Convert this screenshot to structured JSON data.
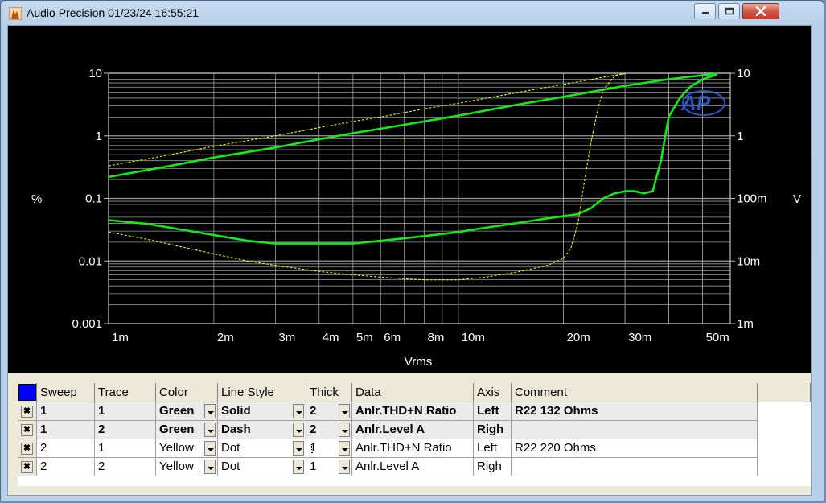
{
  "window": {
    "title": "Audio Precision  01/23/24 16:55:21",
    "minimize_label": "",
    "maximize_label": "",
    "close_label": ""
  },
  "colors": {
    "graph_bg": "#000000",
    "grid": "#9a9a9a",
    "trace_primary": "#18e818",
    "trace_secondary": "#f0f000",
    "selection": "#0000ff"
  },
  "chart_data": {
    "type": "line",
    "xlabel": "Vrms",
    "ylabel_left": "%",
    "ylabel_right": "V",
    "x_scale": "log",
    "y_scale": "log",
    "xlim": [
      0.001,
      0.06
    ],
    "ylim": [
      0.001,
      10
    ],
    "right_ylim": [
      0.001,
      10
    ],
    "grid": true,
    "watermark": "AP",
    "x_ticks": [
      {
        "value": 0.001,
        "label": "1m"
      },
      {
        "value": 0.002,
        "label": "2m"
      },
      {
        "value": 0.003,
        "label": "3m"
      },
      {
        "value": 0.004,
        "label": "4m"
      },
      {
        "value": 0.005,
        "label": "5m"
      },
      {
        "value": 0.006,
        "label": "6m"
      },
      {
        "value": 0.008,
        "label": "8m"
      },
      {
        "value": 0.01,
        "label": "10m"
      },
      {
        "value": 0.02,
        "label": "20m"
      },
      {
        "value": 0.03,
        "label": "30m"
      },
      {
        "value": 0.05,
        "label": "50m"
      }
    ],
    "y_ticks_left": [
      {
        "value": 10,
        "label": "10"
      },
      {
        "value": 1,
        "label": "1"
      },
      {
        "value": 0.1,
        "label": "0.1"
      },
      {
        "value": 0.01,
        "label": "0.01"
      },
      {
        "value": 0.001,
        "label": "0.001"
      }
    ],
    "y_ticks_right": [
      {
        "value": 10,
        "label": "10"
      },
      {
        "value": 1,
        "label": "1"
      },
      {
        "value": 0.1,
        "label": "100m"
      },
      {
        "value": 0.01,
        "label": "10m"
      },
      {
        "value": 0.001,
        "label": "1m"
      }
    ],
    "series": [
      {
        "name": "Anlr.THD+N Ratio",
        "sweep": 1,
        "color": "green",
        "style": "solid",
        "thick": 2,
        "axis": "left",
        "x": [
          0.001,
          0.0013,
          0.0016,
          0.002,
          0.0025,
          0.003,
          0.0035,
          0.004,
          0.0045,
          0.005,
          0.006,
          0.007,
          0.008,
          0.01,
          0.012,
          0.015,
          0.018,
          0.02,
          0.022,
          0.024,
          0.026,
          0.028,
          0.03,
          0.032,
          0.034,
          0.036,
          0.038,
          0.04,
          0.043,
          0.046,
          0.05,
          0.055
        ],
        "y": [
          0.045,
          0.039,
          0.032,
          0.026,
          0.021,
          0.019,
          0.019,
          0.019,
          0.019,
          0.019,
          0.021,
          0.023,
          0.025,
          0.029,
          0.034,
          0.041,
          0.048,
          0.052,
          0.056,
          0.07,
          0.1,
          0.12,
          0.13,
          0.13,
          0.12,
          0.13,
          0.4,
          2.0,
          4.0,
          6.0,
          8.0,
          9.5
        ]
      },
      {
        "name": "Anlr.Level A",
        "sweep": 1,
        "color": "green",
        "style": "dash",
        "thick": 2,
        "axis": "right",
        "x": [
          0.001,
          0.0015,
          0.002,
          0.003,
          0.004,
          0.005,
          0.006,
          0.008,
          0.01,
          0.015,
          0.02,
          0.03,
          0.04,
          0.05,
          0.055
        ],
        "y": [
          0.22,
          0.33,
          0.45,
          0.65,
          0.88,
          1.1,
          1.3,
          1.7,
          2.1,
          3.2,
          4.2,
          6.3,
          8.0,
          9.3,
          9.8
        ]
      },
      {
        "name": "Anlr.THD+N Ratio",
        "sweep": 2,
        "color": "yellow",
        "style": "dot",
        "thick": 1,
        "axis": "left",
        "x": [
          0.001,
          0.0013,
          0.0016,
          0.002,
          0.0025,
          0.003,
          0.004,
          0.005,
          0.006,
          0.007,
          0.008,
          0.01,
          0.012,
          0.015,
          0.018,
          0.02,
          0.021,
          0.022,
          0.023,
          0.024,
          0.025,
          0.026,
          0.028,
          0.03
        ],
        "y": [
          0.029,
          0.022,
          0.017,
          0.013,
          0.01,
          0.0085,
          0.0068,
          0.006,
          0.0055,
          0.0052,
          0.005,
          0.005,
          0.0055,
          0.0068,
          0.0085,
          0.011,
          0.016,
          0.04,
          0.2,
          0.8,
          2.5,
          5.5,
          9.0,
          10.0
        ]
      },
      {
        "name": "Anlr.Level A",
        "sweep": 2,
        "color": "yellow",
        "style": "dot",
        "thick": 1,
        "axis": "right",
        "x": [
          0.001,
          0.0015,
          0.002,
          0.003,
          0.004,
          0.005,
          0.006,
          0.008,
          0.01,
          0.015,
          0.02,
          0.025,
          0.028,
          0.03
        ],
        "y": [
          0.33,
          0.5,
          0.68,
          1.0,
          1.35,
          1.7,
          2.0,
          2.7,
          3.3,
          5.0,
          6.6,
          8.3,
          9.3,
          9.8
        ]
      }
    ]
  },
  "table": {
    "headers": [
      "",
      "Sweep",
      "Trace",
      "Color",
      "Line Style",
      "Thick",
      "Data",
      "Axis",
      "Comment"
    ],
    "rows": [
      {
        "sweep": "1",
        "trace": "1",
        "color": "Green",
        "line_style": "Solid",
        "thick": "2",
        "data": "Anlr.THD+N Ratio",
        "axis": "Left",
        "comment": "R22 132 Ohms"
      },
      {
        "sweep": "1",
        "trace": "2",
        "color": "Green",
        "line_style": "Dash",
        "thick": "2",
        "data": "Anlr.Level A",
        "axis": "Righ",
        "comment": ""
      },
      {
        "sweep": "2",
        "trace": "1",
        "color": "Yellow",
        "line_style": "Dot",
        "thick": "1",
        "data": "Anlr.THD+N Ratio",
        "axis": "Left",
        "comment": "R22 220 Ohms"
      },
      {
        "sweep": "2",
        "trace": "2",
        "color": "Yellow",
        "line_style": "Dot",
        "thick": "1",
        "data": "Anlr.Level A",
        "axis": "Righ",
        "comment": ""
      }
    ]
  }
}
